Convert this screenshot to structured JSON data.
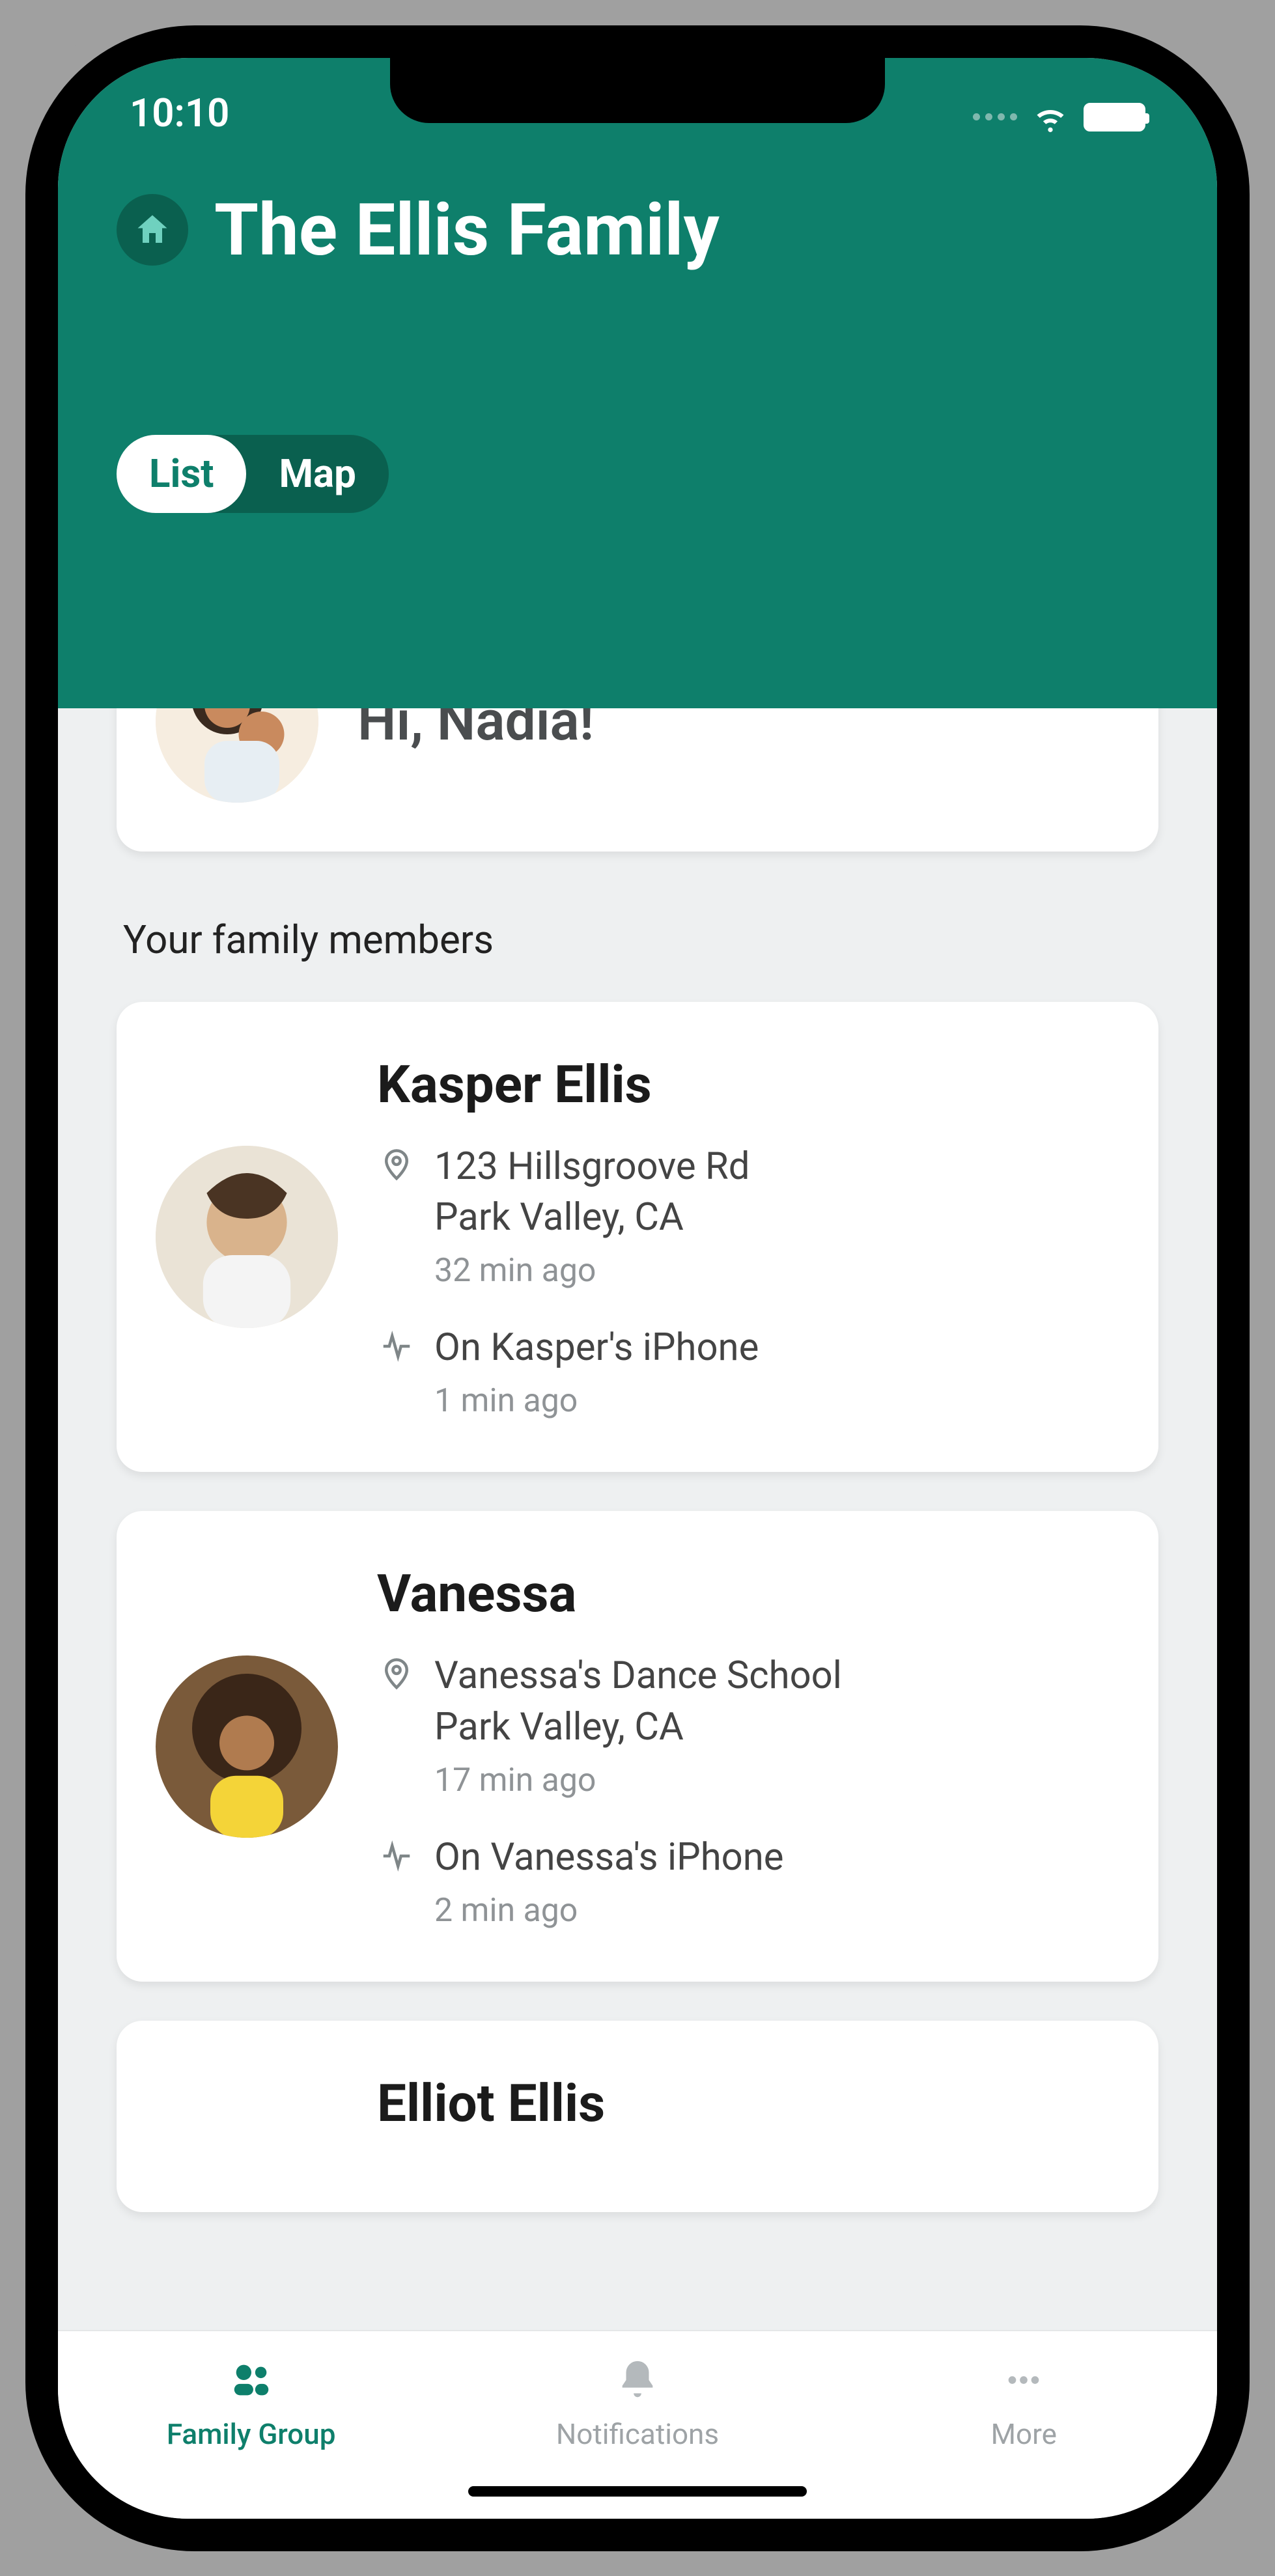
{
  "status": {
    "time": "10:10"
  },
  "header": {
    "title": "The Ellis Family",
    "toggle": {
      "list": "List",
      "map": "Map",
      "active": "list"
    }
  },
  "greeting": {
    "text": "Hi, Nadia!"
  },
  "section": {
    "label": "Your family members"
  },
  "members": [
    {
      "name": "Kasper Ellis",
      "location_line1": "123 Hillsgroove Rd",
      "location_line2": "Park Valley, CA",
      "location_ago": "32 min ago",
      "activity": "On Kasper's iPhone",
      "activity_ago": "1 min ago"
    },
    {
      "name": "Vanessa",
      "location_line1": "Vanessa's Dance School",
      "location_line2": "Park Valley, CA",
      "location_ago": "17 min ago",
      "activity": "On Vanessa's iPhone",
      "activity_ago": "2 min ago"
    },
    {
      "name": "Elliot Ellis",
      "location_line1": "",
      "location_line2": "",
      "location_ago": "",
      "activity": "",
      "activity_ago": ""
    }
  ],
  "nav": {
    "family": "Family Group",
    "notifications": "Notifications",
    "more": "More"
  }
}
